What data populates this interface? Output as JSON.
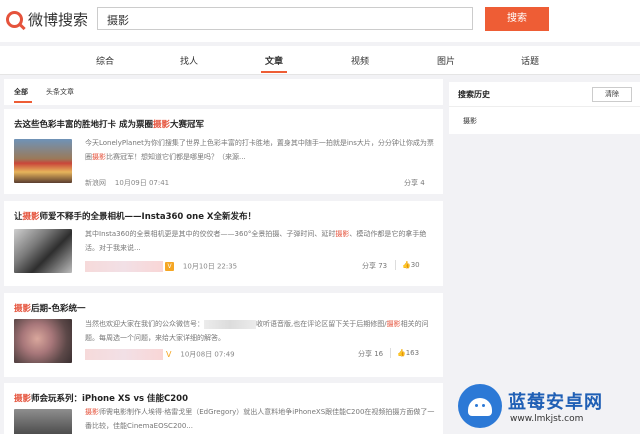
{
  "header": {
    "logo_text": "微博搜索",
    "search_value": "摄影",
    "search_button": "搜索"
  },
  "tabs": [
    {
      "label": "综合"
    },
    {
      "label": "找人"
    },
    {
      "label": "文章"
    },
    {
      "label": "视频"
    },
    {
      "label": "图片"
    },
    {
      "label": "话题"
    }
  ],
  "active_tab": "文章",
  "subtabs": [
    {
      "label": "全部"
    },
    {
      "label": "头条文章"
    }
  ],
  "articles": [
    {
      "title_pre": "去这些色彩丰富的胜地打卡 成为票圈",
      "title_hl": "摄影",
      "title_post": "大赛冠军",
      "desc_pre": "今天LonelyPlanet为你们搜集了世界上色彩丰富的打卡胜地，置身其中随手一拍就是ins大片，分分钟让你成为票圈",
      "desc_hl": "摄影",
      "desc_post": "比赛冠军！想知道它们都是哪里吗？（来源...",
      "source": "新浪网",
      "date": "10月09日 07:41",
      "share": "分享 4"
    },
    {
      "title_pre": "让",
      "title_hl": "摄影",
      "title_post": "师爱不释手的全景相机——Insta360 one X全新发布！",
      "desc_pre": "其中Insta360的全景相机更是其中的佼佼者——360°全景拍摄、子弹时间、延时",
      "desc_hl": "摄影",
      "desc_post": "、模动作都是它的拿手绝活。对于我来说...",
      "date": "10月10日 22:35",
      "share": "分享 73",
      "likes": "30"
    },
    {
      "title_hl": "摄影",
      "title_post": "后期-色彩统一",
      "desc_a": "当然也欢迎大家在我们的公众微信号：",
      "desc_b": "收听语音版,也在评论区留下关于后期修图/",
      "desc_hl": "摄影",
      "desc_c": "相关的问题。每周选一个问题，来给大家详细的解答。",
      "date": "10月08日 07:49",
      "share": "分享 16",
      "likes": "163"
    },
    {
      "title_hl": "摄影",
      "title_post": "师会玩系列：iPhone XS vs 佳能C200",
      "desc_hl": "摄影",
      "desc_post": "师需电影制作人埃得·格雷戈里（EdGregory）就出人意料地争iPhoneXS跟佳能C200在视频拍摄方面做了一番比较，佳能CinemaEOSC200..."
    }
  ],
  "sidebar": {
    "title": "搜索历史",
    "clear_button": "清除",
    "history": [
      "摄影"
    ]
  },
  "watermark": {
    "title": "蓝莓安卓网",
    "url": "www.lmkjst.com"
  }
}
